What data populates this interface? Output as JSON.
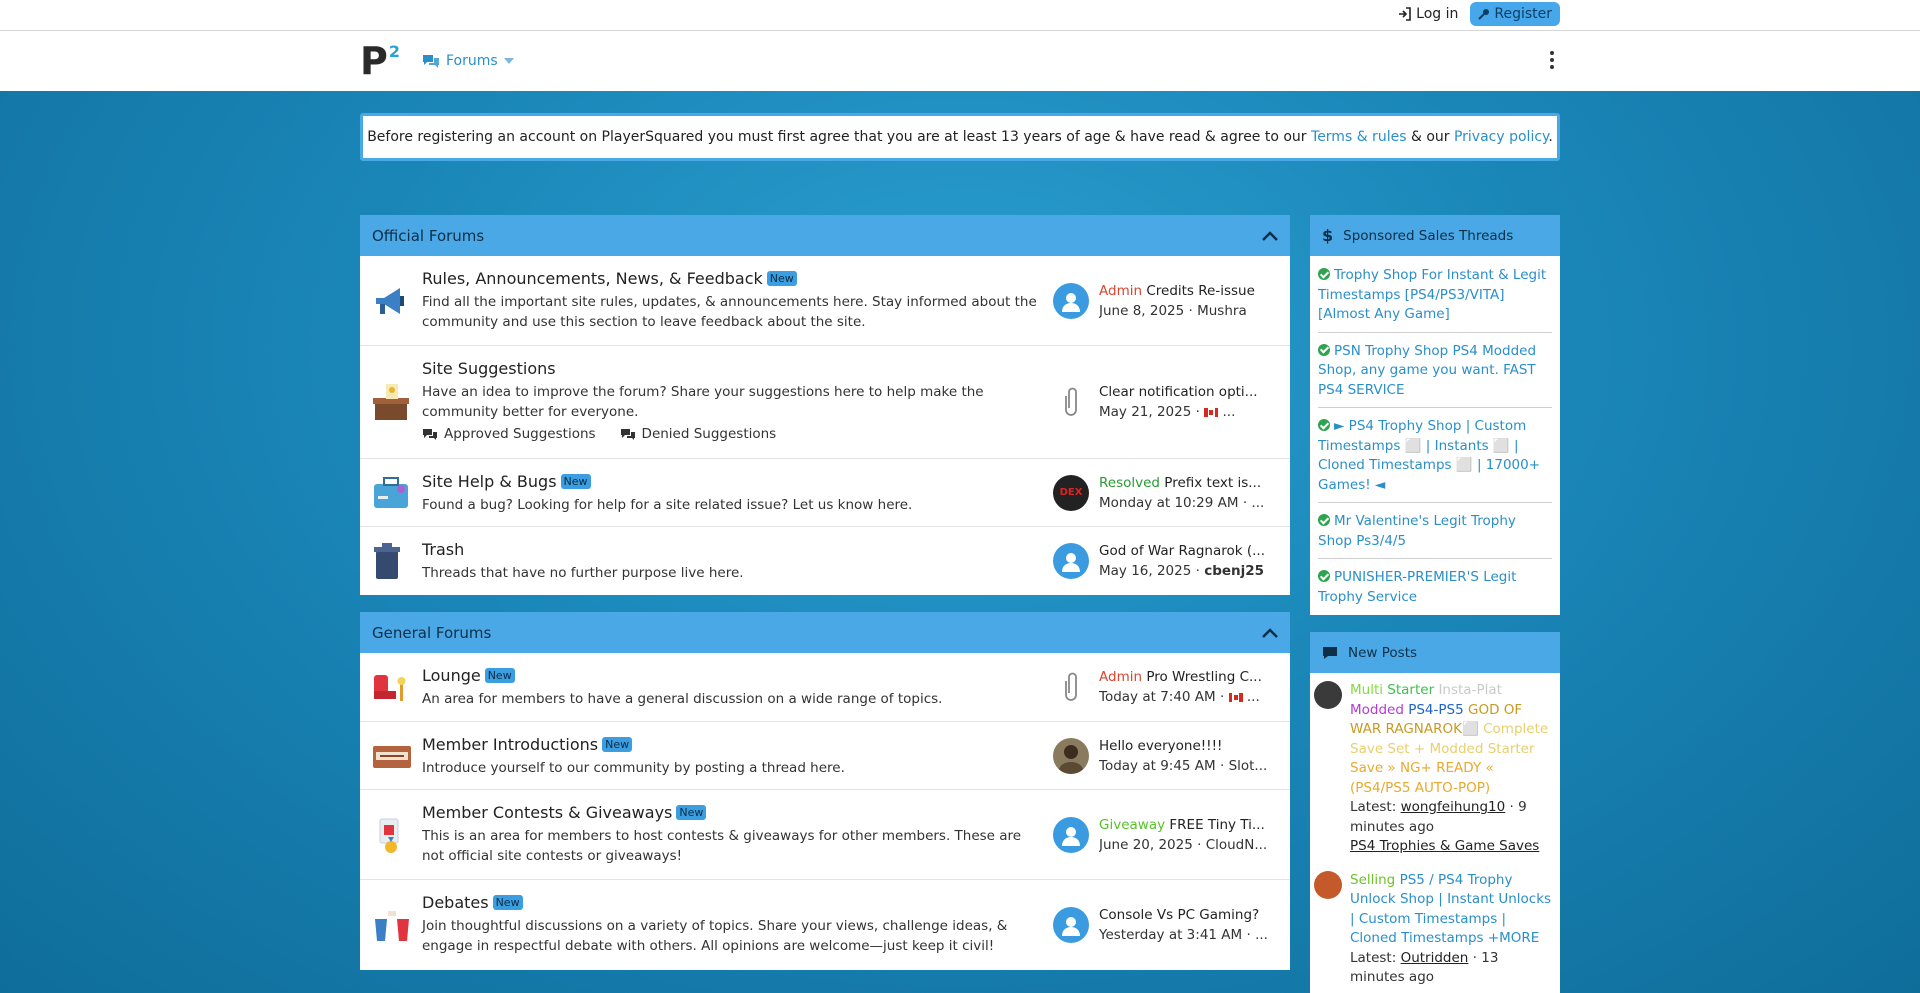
{
  "topbar": {
    "login_label": "Log in",
    "register_label": "Register"
  },
  "navbar": {
    "logo_letter": "P",
    "logo_sup": "2",
    "forums_label": "Forums"
  },
  "notice": {
    "text_before": "Before registering an account on PlayerSquared you must first agree that you are at least ",
    "age": "13",
    "text_mid": " years of age & have read & agree to our ",
    "terms_link": "Terms & rules",
    "text_and": " & our ",
    "privacy_link": "Privacy policy",
    "text_end": "."
  },
  "official": {
    "title": "Official Forums",
    "nodes": [
      {
        "title": "Rules, Announcements, News, & Feedback",
        "new": "New",
        "desc": "Find all the important site rules, updates, & announcements here. Stay informed about the community and use this section to leave feedback about the site.",
        "last_prefix": "Admin",
        "last_title": "Credits Re-issue",
        "last_date": "June 8, 2025",
        "last_user": "Mushra"
      },
      {
        "title": "Site Suggestions",
        "desc": "Have an idea to improve the forum? Share your suggestions here to help make the community better for everyone.",
        "sub1": "Approved Suggestions",
        "sub2": "Denied Suggestions",
        "last_title": "Clear notification opti...",
        "last_date": "May 21, 2025",
        "last_user": "..."
      },
      {
        "title": "Site Help & Bugs",
        "new": "New",
        "desc": "Found a bug? Looking for help for a site related issue? Let us know here.",
        "last_prefix": "Resolved",
        "last_title": "Prefix text is...",
        "last_date": "Monday at 10:29 AM",
        "last_user": "...",
        "avatar_text": "DEX"
      },
      {
        "title": "Trash",
        "desc": "Threads that have no further purpose live here.",
        "last_title": "God of War Ragnarok (...",
        "last_date": "May 16, 2025",
        "last_user": "cbenj25"
      }
    ]
  },
  "general": {
    "title": "General Forums",
    "nodes": [
      {
        "title": "Lounge",
        "new": "New",
        "desc": "An area for members to have a general discussion on a wide range of topics.",
        "last_prefix": "Admin",
        "last_title": "Pro Wrestling C...",
        "last_date": "Today at 7:40 AM",
        "last_user": "..."
      },
      {
        "title": "Member Introductions",
        "new": "New",
        "desc": "Introduce yourself to our community by posting a thread here.",
        "last_title": "Hello everyone!!!!",
        "last_date": "Today at 9:45 AM",
        "last_user": "Slot..."
      },
      {
        "title": "Member Contests & Giveaways",
        "new": "New",
        "desc": "This is an area for members to host contests & giveaways for other members. These are not official site contests or giveaways!",
        "last_prefix": "Giveaway",
        "last_title": "FREE Tiny Ti...",
        "last_date": "June 20, 2025",
        "last_user": "CloudN..."
      },
      {
        "title": "Debates",
        "new": "New",
        "desc": "Join thoughtful discussions on a variety of topics. Share your views, challenge ideas, & engage in respectful debate with others. All opinions are welcome—just keep it civil!",
        "last_title": "Console Vs PC Gaming?",
        "last_date": "Yesterday at 3:41 AM",
        "last_user": "..."
      }
    ]
  },
  "sponsored": {
    "title": "Sponsored Sales Threads",
    "items": [
      "Trophy Shop For Instant & Legit Timestamps [PS4/PS3/VITA] [Almost Any Game]",
      "PSN Trophy Shop PS4 Modded Shop, any game you want. FAST PS4 SERVICE",
      "► PS4 Trophy Shop | Custom Timestamps ⬜ | Instants ⬜ | Cloned Timestamps ⬜ | 17000+ Games! ◄",
      "Mr Valentine's Legit Trophy Shop Ps3/4/5",
      "PUNISHER-PREMIER'S Legit Trophy Service"
    ]
  },
  "new_posts": {
    "title": "New Posts",
    "posts": [
      {
        "p1": "Multi",
        "p2": "Starter",
        "p3": "Insta-Plat",
        "p4": "Modded",
        "p5": "PS4-PS5",
        "p6": "GOD OF WAR RAGNAROK",
        "p6b": "⬜ Complete Save Set + Modded Starter",
        "p7": "Save » NG+ READY « (PS4/PS5 AUTO-POP)",
        "latest_label": "Latest:",
        "user": "wongfeihung10",
        "time": "9 minutes ago",
        "forum": "PS4 Trophies & Game Saves"
      },
      {
        "prefix": "Selling",
        "title": "PS5 / PS4 Trophy Unlock Shop | Instant Unlocks | Custom Timestamps | Cloned Timestamps +MORE",
        "latest_label": "Latest:",
        "user": "Outridden",
        "time": "13 minutes ago"
      }
    ]
  },
  "colors": {
    "accent": "#4aa8e6",
    "link": "#2a8fc9",
    "admin": "#d9452f",
    "resolved": "#2a9a32"
  }
}
